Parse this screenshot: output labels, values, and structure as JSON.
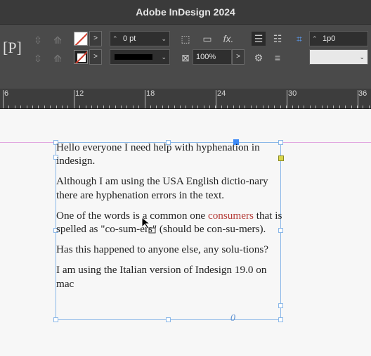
{
  "window": {
    "title": "Adobe InDesign 2024"
  },
  "control_panel": {
    "stroke_weight": "0 pt",
    "opacity": "100%",
    "spacing_value": "1p0",
    "fx_label": "fx."
  },
  "ruler": {
    "labels": [
      "6",
      "12",
      "18",
      "24",
      "30",
      "36"
    ]
  },
  "document": {
    "paragraphs": [
      "Hello everyone I need help with hyphenation in indesign.",
      "Although I am using the USA English dictio-nary there are hyphenation errors in the text.",
      {
        "before": "One of the words is a common one ",
        "highlight": "consumers",
        "after": " that is spelled as \"co-sum-ers\" (should be con-su-mers)."
      },
      "Has this happened to anyone else, any solu-tions?",
      "I am using the Italian version of Indesign 19.0 on mac"
    ],
    "highlight_color": "#b43a36",
    "guide_color": "#e2a8e0",
    "frame_color": "#8bb8e8"
  },
  "frame_indicator": "0"
}
